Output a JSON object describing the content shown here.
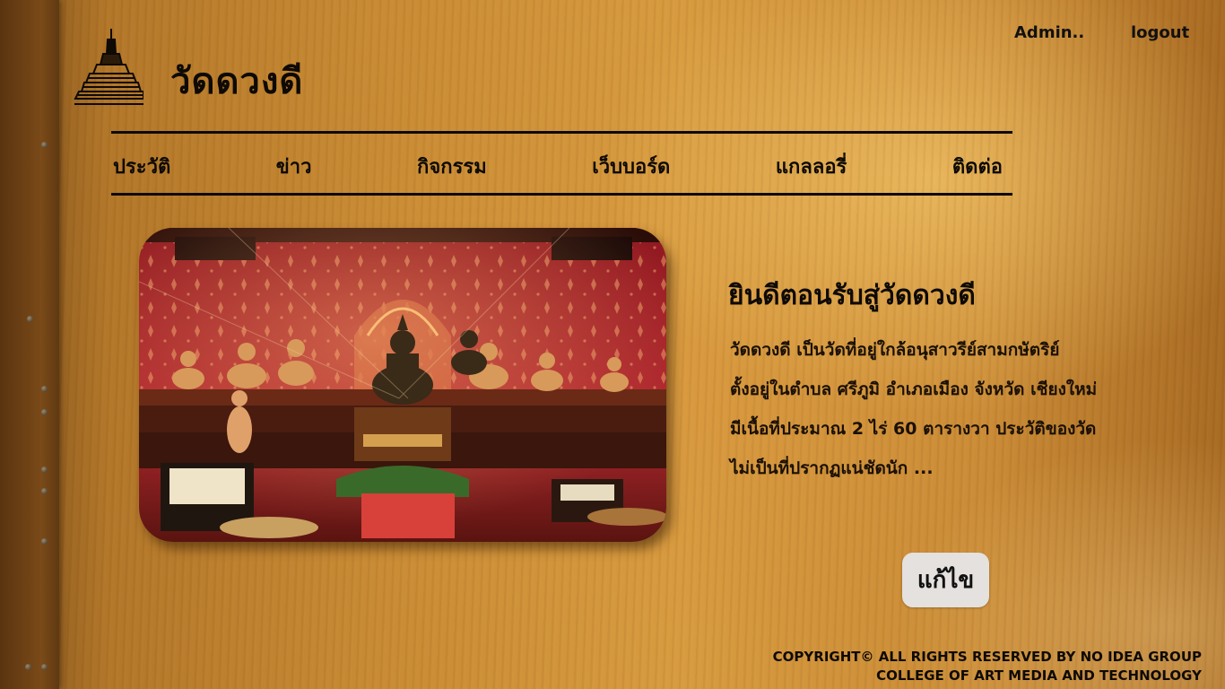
{
  "header": {
    "site_title": "วัดดวงดี",
    "logo_icon": "stupa-icon",
    "admin_label": "Admin..",
    "logout_label": "logout"
  },
  "nav": {
    "items": [
      {
        "label": "ประวัติ"
      },
      {
        "label": "ข่าว"
      },
      {
        "label": "กิจกรรม"
      },
      {
        "label": "เว็บบอร์ด"
      },
      {
        "label": "แกลลอรี่"
      },
      {
        "label": "ติดต่อ"
      }
    ]
  },
  "main": {
    "welcome_title": "ยินดีตอนรับสู่วัดดวงดี",
    "intro_lines": [
      "วัดดวงดี เป็นวัดที่อยู่ใกล้อนุสาวรีย์สามกษัตริย์",
      "ตั้งอยู่ในตำบล ศรีภูมิ อำเภอเมือง จังหวัด เชียงใหม่",
      "มีเนื้อที่ประมาณ 2 ไร่ 60 ตารางวา ประวัติของวัด",
      "ไม่เป็นที่ปรากฏแน่ชัดนัก ..."
    ],
    "edit_button_label": "แก้ไข"
  },
  "footer": {
    "line1": "COPYRIGHT©  ALL RIGHTS RESERVED BY NO IDEA GROUP",
    "line2": "COLLEGE OF ART MEDIA AND TECHNOLOGY"
  },
  "colors": {
    "text": "#0e0a05",
    "wood": "#c88a33",
    "button_bg": "#e4e1de",
    "temple_red": "#b3282f"
  }
}
